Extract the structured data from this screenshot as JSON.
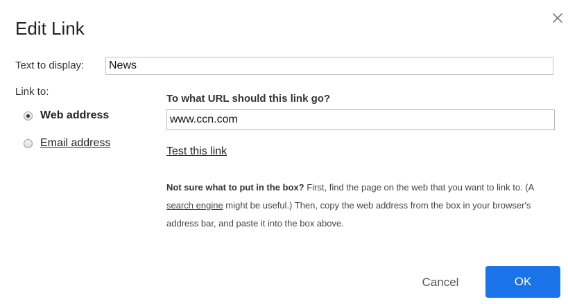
{
  "dialog": {
    "title": "Edit Link",
    "close_icon": "close-icon"
  },
  "display": {
    "label": "Text to display:",
    "value": "News"
  },
  "link_to": {
    "label": "Link to:",
    "options": [
      {
        "label": "Web address",
        "selected": true
      },
      {
        "label": "Email address",
        "selected": false
      }
    ]
  },
  "url": {
    "heading": "To what URL should this link go?",
    "value": "www.ccn.com",
    "test_link": "Test this link"
  },
  "help": {
    "bold_lead": "Not sure what to put in the box?",
    "text_1": " First, find the page on the web that you want to link to. (A ",
    "search_link": "search engine",
    "text_2": " might be useful.) Then, copy the web address from the box in your browser's address bar, and paste it into the box above."
  },
  "buttons": {
    "cancel": "Cancel",
    "ok": "OK"
  },
  "colors": {
    "primary": "#1a73e8"
  }
}
